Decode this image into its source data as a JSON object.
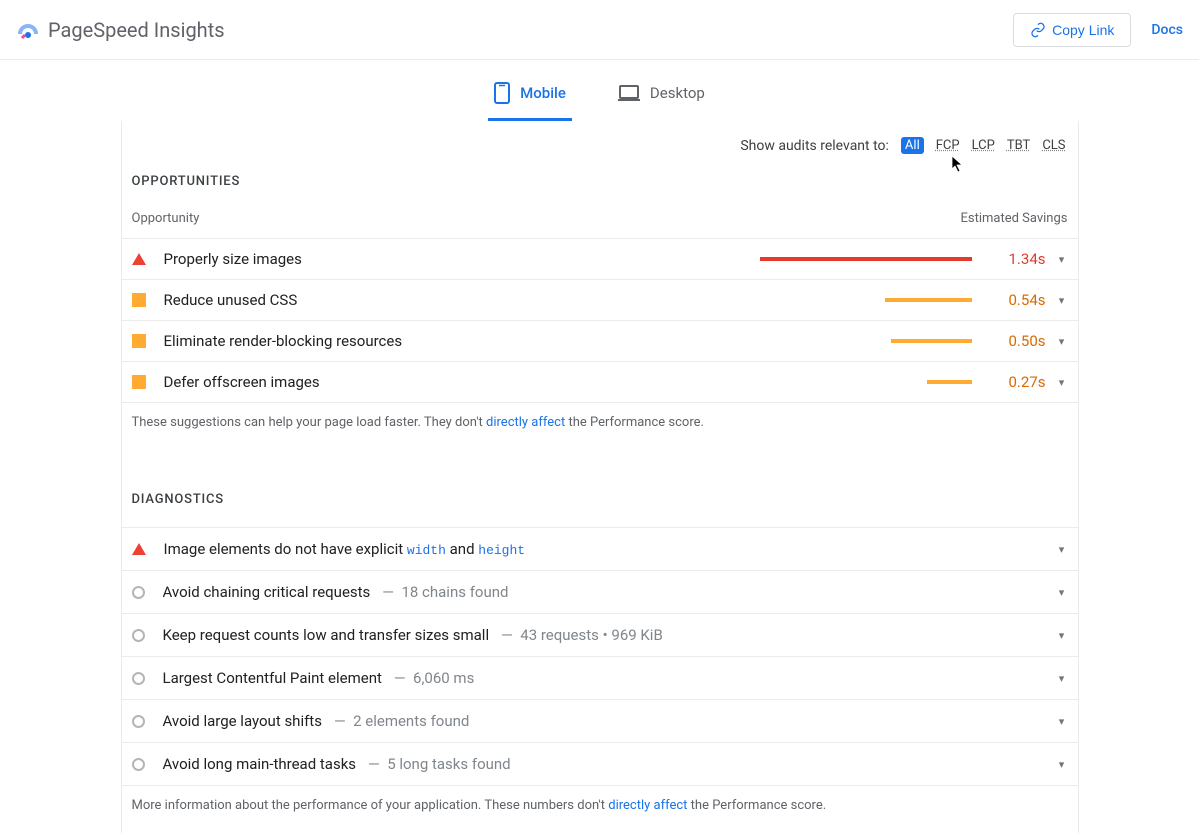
{
  "header": {
    "brand": "PageSpeed Insights",
    "copy_link": "Copy Link",
    "docs": "Docs"
  },
  "tabs": {
    "mobile": "Mobile",
    "desktop": "Desktop"
  },
  "filter": {
    "label": "Show audits relevant to:",
    "all": "All",
    "fcp": "FCP",
    "lcp": "LCP",
    "tbt": "TBT",
    "cls": "CLS"
  },
  "opportunities": {
    "heading": "OPPORTUNITIES",
    "col_left": "Opportunity",
    "col_right": "Estimated Savings",
    "rows": [
      {
        "title": "Properly size images",
        "savings": "1.34s",
        "severity": "red",
        "bar_pct": 100
      },
      {
        "title": "Reduce unused CSS",
        "savings": "0.54s",
        "severity": "orange",
        "bar_pct": 41
      },
      {
        "title": "Eliminate render-blocking resources",
        "savings": "0.50s",
        "severity": "orange",
        "bar_pct": 38
      },
      {
        "title": "Defer offscreen images",
        "savings": "0.27s",
        "severity": "orange",
        "bar_pct": 21
      }
    ],
    "footnote_pre": "These suggestions can help your page load faster. They don't ",
    "footnote_link": "directly affect",
    "footnote_post": " the Performance score."
  },
  "diagnostics": {
    "heading": "DIAGNOSTICS",
    "rows": [
      {
        "marker": "triangle",
        "title_pre": "Image elements do not have explicit ",
        "code1": "width",
        "mid": " and ",
        "code2": "height",
        "detail": ""
      },
      {
        "marker": "circle",
        "title_pre": "Avoid chaining critical requests",
        "detail": "18 chains found"
      },
      {
        "marker": "circle",
        "title_pre": "Keep request counts low and transfer sizes small",
        "detail": "43 requests • 969 KiB"
      },
      {
        "marker": "circle",
        "title_pre": "Largest Contentful Paint element",
        "detail": "6,060 ms"
      },
      {
        "marker": "circle",
        "title_pre": "Avoid large layout shifts",
        "detail": "2 elements found"
      },
      {
        "marker": "circle",
        "title_pre": "Avoid long main-thread tasks",
        "detail": "5 long tasks found"
      }
    ],
    "footnote_pre": "More information about the performance of your application. These numbers don't ",
    "footnote_link": "directly affect",
    "footnote_post": " the Performance score."
  }
}
